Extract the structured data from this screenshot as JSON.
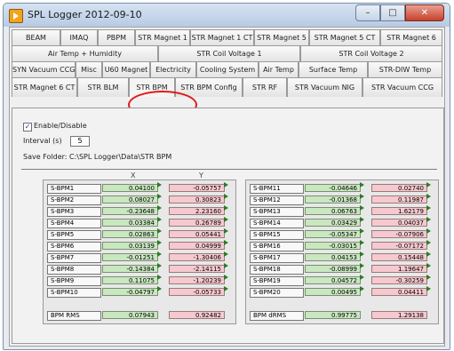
{
  "window": {
    "title": "SPL Logger 2012-09-10",
    "min": "–",
    "max": "□",
    "close": "✕"
  },
  "tabs": {
    "row1": [
      "BEAM",
      "IMAQ",
      "PBPM",
      "STR Magnet 1",
      "STR Magnet 1 CT",
      "STR Magnet 5",
      "STR Magnet 5 CT",
      "STR Magnet 6"
    ],
    "row2": [
      "Air Temp + Humidity",
      "STR Coil Voltage 1",
      "STR Coil Voltage 2"
    ],
    "row3": [
      "SYN Vacuum CCG",
      "Misc",
      "U60 Magnet",
      "Electricity",
      "Cooling System",
      "Air Temp",
      "Surface Temp",
      "STR-DIW Temp"
    ],
    "row4": [
      "STR Magnet 6 CT",
      "STR BLM",
      "STR BPM",
      "STR BPM Config",
      "STR RF",
      "STR Vacuum NIG",
      "STR Vacuum CCG"
    ],
    "active": "STR BPM"
  },
  "panel": {
    "enable_label": "Enable/Disable",
    "checked_mark": "✓",
    "interval_label": "Interval (s)",
    "interval_value": "5",
    "save_folder": "Save Folder: C:\\SPL Logger\\Data\\STR BPM",
    "x_header": "X",
    "y_header": "Y"
  },
  "bpm_left": [
    {
      "name": "S-BPM1",
      "x": "0.04100",
      "y": "-0.05757"
    },
    {
      "name": "S-BPM2",
      "x": "0.08027",
      "y": "0.30823"
    },
    {
      "name": "S-BPM3",
      "x": "-0.23648",
      "y": "2.23160"
    },
    {
      "name": "S-BPM4",
      "x": "0.03384",
      "y": "0.26789"
    },
    {
      "name": "S-BPM5",
      "x": "0.02863",
      "y": "0.05441"
    },
    {
      "name": "S-BPM6",
      "x": "0.03139",
      "y": "0.04999"
    },
    {
      "name": "S-BPM7",
      "x": "-0.01251",
      "y": "-1.30406"
    },
    {
      "name": "S-BPM8",
      "x": "-0.14384",
      "y": "-2.14115"
    },
    {
      "name": "S-BPM9",
      "x": "0.11075",
      "y": "-1.20239"
    },
    {
      "name": "S-BPM10",
      "x": "-0.04797",
      "y": "-0.05733"
    }
  ],
  "bpm_right": [
    {
      "name": "S-BPM11",
      "x": "-0.04646",
      "y": "0.02740"
    },
    {
      "name": "S-BPM12",
      "x": "-0.01368",
      "y": "0.11987"
    },
    {
      "name": "S-BPM13",
      "x": "0.06763",
      "y": "1.62179"
    },
    {
      "name": "S-BPM14",
      "x": "0.03429",
      "y": "0.04037"
    },
    {
      "name": "S-BPM15",
      "x": "-0.05347",
      "y": "-0.07906"
    },
    {
      "name": "S-BPM16",
      "x": "-0.03015",
      "y": "-0.07172"
    },
    {
      "name": "S-BPM17",
      "x": "0.04153",
      "y": "0.15448"
    },
    {
      "name": "S-BPM18",
      "x": "-0.08999",
      "y": "1.19647"
    },
    {
      "name": "S-BPM19",
      "x": "0.04572",
      "y": "-0.30259"
    },
    {
      "name": "S-BPM20",
      "x": "0.00495",
      "y": "0.04411"
    }
  ],
  "summary_left": {
    "name": "BPM RMS",
    "x": "0.07943",
    "y": "0.92482"
  },
  "summary_right": {
    "name": "BPM dRMS",
    "x": "0.99775",
    "y": "1.29138"
  },
  "colors": {
    "x_fill": "#c9e7c1",
    "y_fill": "#f5c9cf",
    "highlight_ring": "#e11b1b"
  }
}
